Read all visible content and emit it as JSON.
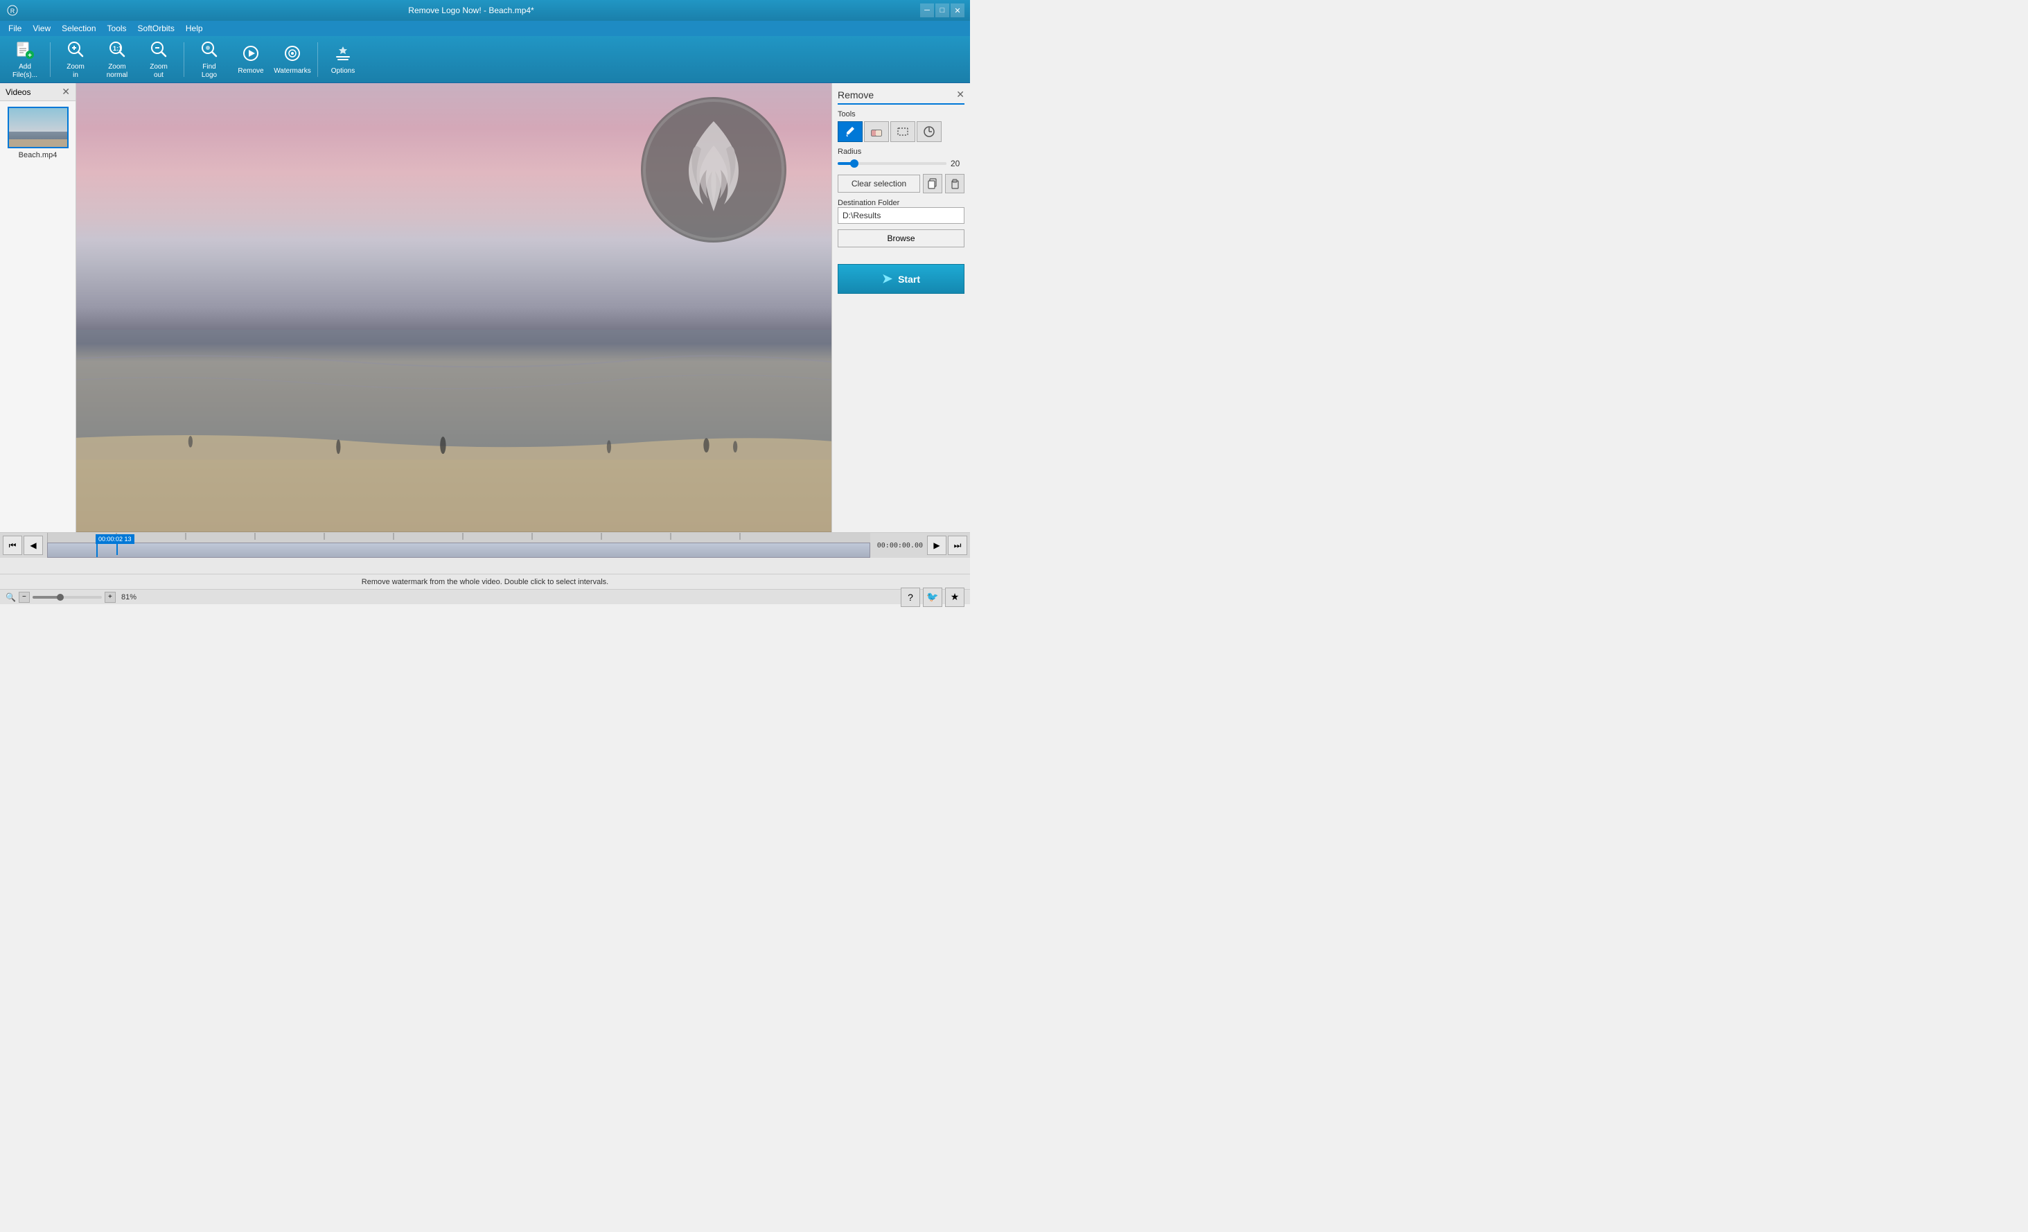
{
  "app": {
    "title": "Remove Logo Now! - Beach.mp4*",
    "icon": "🎬"
  },
  "titlebar": {
    "minimize_label": "─",
    "maximize_label": "□",
    "close_label": "✕"
  },
  "menu": {
    "items": [
      "File",
      "View",
      "Selection",
      "Tools",
      "SoftOrbits",
      "Help"
    ]
  },
  "toolbar": {
    "buttons": [
      {
        "id": "add-files",
        "icon": "📄",
        "label": "Add\nFile(s)..."
      },
      {
        "id": "zoom-in",
        "icon": "🔍",
        "label": "Zoom\nin"
      },
      {
        "id": "zoom-normal",
        "icon": "🔍",
        "label": "Zoom\nnormal"
      },
      {
        "id": "zoom-out",
        "icon": "🔍",
        "label": "Zoom\nout"
      },
      {
        "id": "find-logo",
        "icon": "🔎",
        "label": "Find\nLogo"
      },
      {
        "id": "remove",
        "icon": "▶",
        "label": "Remove"
      },
      {
        "id": "watermarks",
        "icon": "◉",
        "label": "Watermarks"
      },
      {
        "id": "options",
        "icon": "✏",
        "label": "Options"
      }
    ]
  },
  "videos_panel": {
    "title": "Videos",
    "video": {
      "name": "Beach.mp4",
      "thumbnail_alt": "Beach video thumbnail"
    }
  },
  "remove_panel": {
    "title": "Remove",
    "tools_label": "Tools",
    "tools": [
      {
        "id": "brush",
        "icon": "✏",
        "tooltip": "Brush tool",
        "active": true
      },
      {
        "id": "eraser",
        "icon": "◪",
        "tooltip": "Eraser tool",
        "active": false
      },
      {
        "id": "rect",
        "icon": "▭",
        "tooltip": "Rectangle tool",
        "active": false
      },
      {
        "id": "clock",
        "icon": "◔",
        "tooltip": "Interval tool",
        "active": false
      }
    ],
    "radius_label": "Radius",
    "radius_value": "20",
    "radius_percent": 15,
    "clear_selection_label": "Clear selection",
    "destination_folder_label": "Destination Folder",
    "destination_folder_value": "D:\\Results",
    "browse_label": "Browse",
    "start_label": "Start"
  },
  "timeline": {
    "current_time": "00:00:02 13",
    "start_time": "00:00:00.00",
    "end_buttons": [
      "⏮",
      "⏭"
    ]
  },
  "status_bar": {
    "message": "Remove watermark from the whole video. Double click to select intervals."
  },
  "zoom_bar": {
    "level": "81%",
    "minus_label": "−",
    "plus_label": "+"
  }
}
